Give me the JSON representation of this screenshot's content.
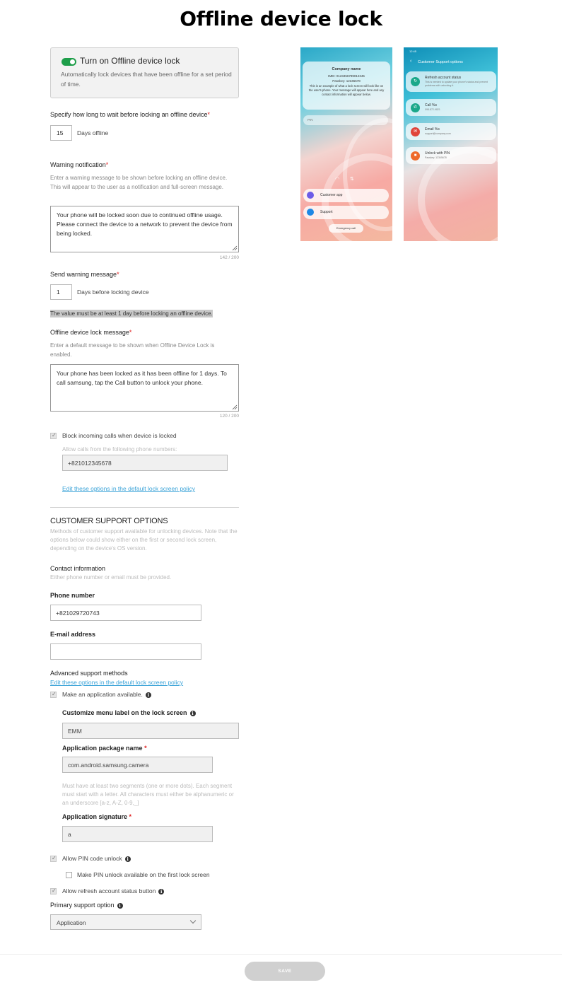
{
  "page": {
    "title": "Offline device lock"
  },
  "toggle": {
    "label": "Turn on Offline device lock",
    "description": "Automatically lock devices that have been offline for a set period of time."
  },
  "wait": {
    "label": "Specify how long to wait before locking an offline device",
    "value": "15",
    "unit": "Days offline"
  },
  "warning": {
    "label": "Warning notification",
    "help": "Enter a warning message to be shown before locking an offline device. This will appear to the user as a notification and full-screen message.",
    "text": "Your phone will be locked soon due to continued offline usage. Please connect the device to a network to prevent the device from being locked.",
    "counter": "142 / 200"
  },
  "send_warning": {
    "label": "Send warning message",
    "value": "1",
    "unit": "Days before locking device",
    "validation": "The value must be at least 1 day before locking an offline device."
  },
  "lock_message": {
    "label": "Offline device lock message",
    "help": "Enter a default message to be shown when Offline Device Lock is enabled.",
    "text": "Your phone has been locked as it has been offline for 1 days. To call samsung, tap the Call button to unlock your phone.",
    "counter": "120 / 200"
  },
  "block_calls": {
    "label": "Block incoming calls when device is locked",
    "checked": true,
    "allow_label": "Allow calls from the following phone numbers:",
    "allow_value": "+821012345678",
    "link": "Edit these options in the default lock screen policy"
  },
  "support": {
    "heading": "CUSTOMER SUPPORT OPTIONS",
    "description": "Methods of customer support available for unlocking devices. Note that the options below could show either on the first or second lock screen, depending on the device's OS version.",
    "contact_label": "Contact information",
    "contact_help": "Either phone number or email must be provided.",
    "phone_label": "Phone number",
    "phone_value": "+821029720743",
    "email_label": "E-mail address",
    "email_value": "",
    "advanced_label": "Advanced support methods",
    "advanced_link": "Edit these options in the default lock screen policy",
    "make_app_label": "Make an application available.",
    "menu_label": "Customize menu label on the lock screen",
    "menu_value": "EMM",
    "package_label": "Application package name",
    "package_value": "com.android.samsung.camera",
    "package_help": "Must have at least two segments (one or more dots). Each segment must start with a letter. All characters must either be alphanumeric or an underscore [a-z, A-Z, 0-9,_]",
    "signature_label": "Application signature",
    "signature_value": "a",
    "pin_label": "Allow PIN code unlock",
    "pin_first_label": "Make PIN unlock available on the first lock screen",
    "refresh_label": "Allow refresh account status button",
    "primary_label": "Primary support option",
    "primary_value": "Application"
  },
  "footer": {
    "save_label": "SAVE"
  },
  "preview1": {
    "company": "Company name",
    "imei": "IMEI: 0123456789012345",
    "passkey": "Passkey: 12345678",
    "body": "This is an example of what a lock screen will look like on the user's phone. Your message will appear here and any contact information will appear below.",
    "pin_placeholder": "PIN",
    "customer_app": "Customer app",
    "support": "Support",
    "emergency": "Emergency call"
  },
  "preview2": {
    "time": "12:45",
    "header": "Customer Support options",
    "options": [
      {
        "title": "Refresh account status",
        "sub": "This is needed to update your phone's status and prevent problems with unlocking it.",
        "color": "#1aa88a",
        "icon": "refresh-icon"
      },
      {
        "title": "Call %s",
        "sub": "098-872-9821",
        "color": "#1aa88a",
        "icon": "phone-icon"
      },
      {
        "title": "Email %s",
        "sub": "support@company.com",
        "color": "#e0443a",
        "icon": "mail-icon"
      },
      {
        "title": "Unlock with PIN",
        "sub": "Passkey: 12345678",
        "color": "#ee6a2a",
        "icon": "lock-icon"
      }
    ]
  },
  "colors": {
    "toggle_on": "#1e9e4a",
    "link": "#3aa3d8",
    "required": "#e02020",
    "save_disabled": "#d0d0d0"
  }
}
